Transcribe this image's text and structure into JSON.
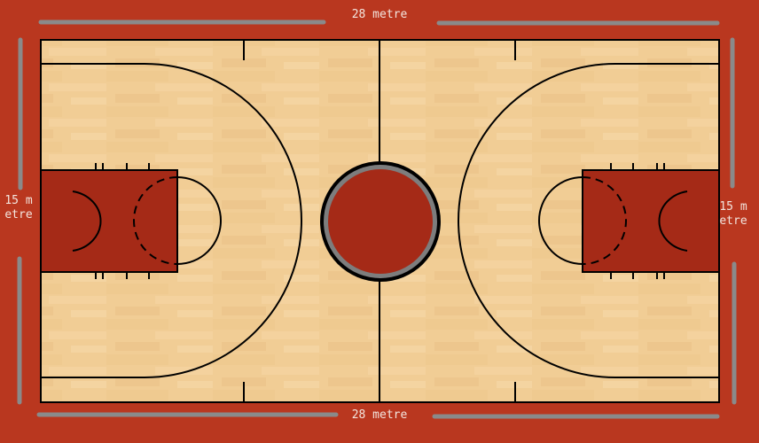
{
  "dimensions": {
    "length_top": "28 metre",
    "length_bottom": "28 metre",
    "width_left": "15 metre",
    "width_right": "15 metre"
  },
  "colors": {
    "apron": "#b9371f",
    "floor_light": "#f2cf97",
    "floor_dark": "#e8bd80",
    "paint": "#a52a17",
    "lines": "#000000",
    "dimension_bar": "#8a8a8a",
    "center_ring": "#7d7d7d"
  }
}
